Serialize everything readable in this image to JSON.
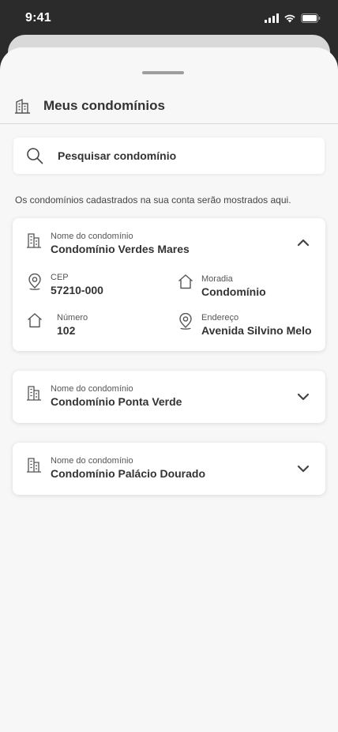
{
  "status_bar": {
    "time": "9:41"
  },
  "header": {
    "title": "Meus condomínios",
    "icon": "building-icon"
  },
  "search": {
    "placeholder": "Pesquisar condomínio",
    "icon": "search-icon"
  },
  "info_text": "Os condomínios cadastrados na sua conta serão mostrados aqui.",
  "condominiums": [
    {
      "name_label": "Nome do condomínio",
      "name": "Condomínio Verdes Mares",
      "expanded": true,
      "details": {
        "cep_label": "CEP",
        "cep": "57210-000",
        "moradia_label": "Moradia",
        "moradia": "Condomínio",
        "numero_label": "Número",
        "numero": "102",
        "endereco_label": "Endereço",
        "endereco": "Avenida Silvino Melo"
      }
    },
    {
      "name_label": "Nome do condomínio",
      "name": "Condomínio Ponta Verde",
      "expanded": false
    },
    {
      "name_label": "Nome do condomínio",
      "name": "Condomínio Palácio Dourado",
      "expanded": false
    }
  ],
  "colors": {
    "sheet_bg": "#f7f7f7",
    "dark_bg": "#2b2b2b",
    "text": "#333333"
  }
}
